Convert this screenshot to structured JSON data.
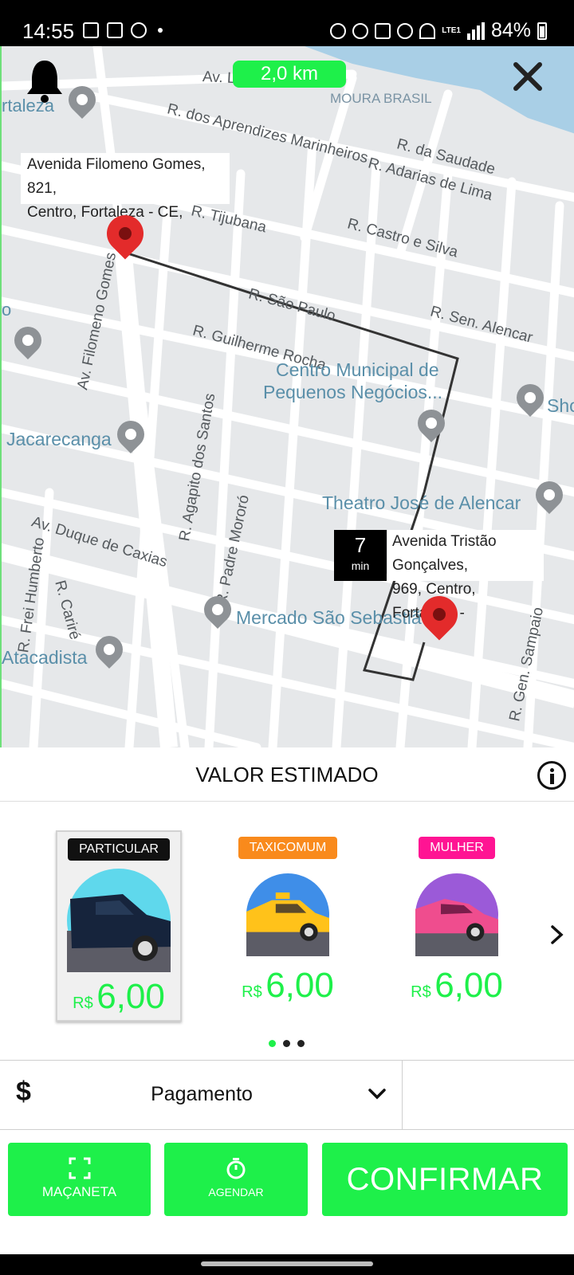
{
  "status_bar": {
    "time": "14:55",
    "battery": "84%",
    "network": "LTE1",
    "left_icons": [
      "gallery-icon",
      "twitch-icon",
      "messenger-icon",
      "dot-icon"
    ],
    "right_icons": [
      "alarm-icon",
      "mute-icon",
      "location-icon",
      "wifi-icon",
      "signal-icon",
      "battery-icon"
    ]
  },
  "map": {
    "distance": "2,0 km",
    "origin_address": "Avenida Filomeno Gomes, 821, Centro, Fortaleza - CE,",
    "origin_line1": "Avenida Filomeno Gomes, 821,",
    "origin_line2": "Centro, Fortaleza - CE,",
    "destination_line1": "Avenida Tristão Gonçalves,",
    "destination_line2": "969, Centro, Fortaleza -",
    "eta_value": "7",
    "eta_unit": "min",
    "street_labels": {
      "av_oeste": "Av. Leste Oeste",
      "moura": "MOURA BRASIL",
      "fortaleza": "rtaleza",
      "aprendizes": "R. dos Aprendizes Marinheiros",
      "saudade": "R. da Saudade",
      "adarias": "R. Adarias de Lima",
      "tijubana": "R. Tijubana",
      "castro": "R. Castro e Silva",
      "filomeno": "Av. Filomeno Gomes",
      "sao_paulo": "R. São Paulo",
      "alencar": "R. Sen. Alencar",
      "guilherme": "R. Guilherme Rocha",
      "agapito": "R. Agapito dos Santos",
      "padre": "R. Padre Mororó",
      "duque": "Av. Duque de Caxias",
      "cariri": "R. Cariré",
      "frei": "R. Frei Humberto",
      "sampaio": "R. Gen. Sampaio",
      "o_edge": "o"
    },
    "poi_labels": {
      "centro_municipal_1": "Centro Municipal de",
      "centro_municipal_2": "Pequenos Negócios...",
      "jacarecanga": "Jacarecanga",
      "theatro": "Theatro José de Alencar",
      "mercado": "Mercado São Sebastião",
      "atacadista": "Atacadista",
      "shop": "Sho"
    }
  },
  "sheet": {
    "title": "VALOR ESTIMADO",
    "categories": [
      {
        "badge": "PARTICULAR",
        "badge_color": "#111111",
        "currency": "R$",
        "price": "6,00",
        "selected": true
      },
      {
        "badge": "TAXICOMUM",
        "badge_color": "#f98a1c",
        "currency": "R$",
        "price": "6,00",
        "selected": false
      },
      {
        "badge": "MULHER",
        "badge_color": "#ff1493",
        "currency": "R$",
        "price": "6,00",
        "selected": false
      }
    ],
    "page_indicator": {
      "count": 3,
      "active": 1
    },
    "payment": {
      "symbol": "$",
      "label": "Pagamento"
    },
    "buttons": {
      "macaneta": "MAÇANETA",
      "agendar": "AGENDAR",
      "confirmar": "CONFIRMAR"
    }
  },
  "colors": {
    "accent": "#1ef04a",
    "route": "#333333",
    "pin": "#e32b2b",
    "water": "#a9cfe6"
  }
}
